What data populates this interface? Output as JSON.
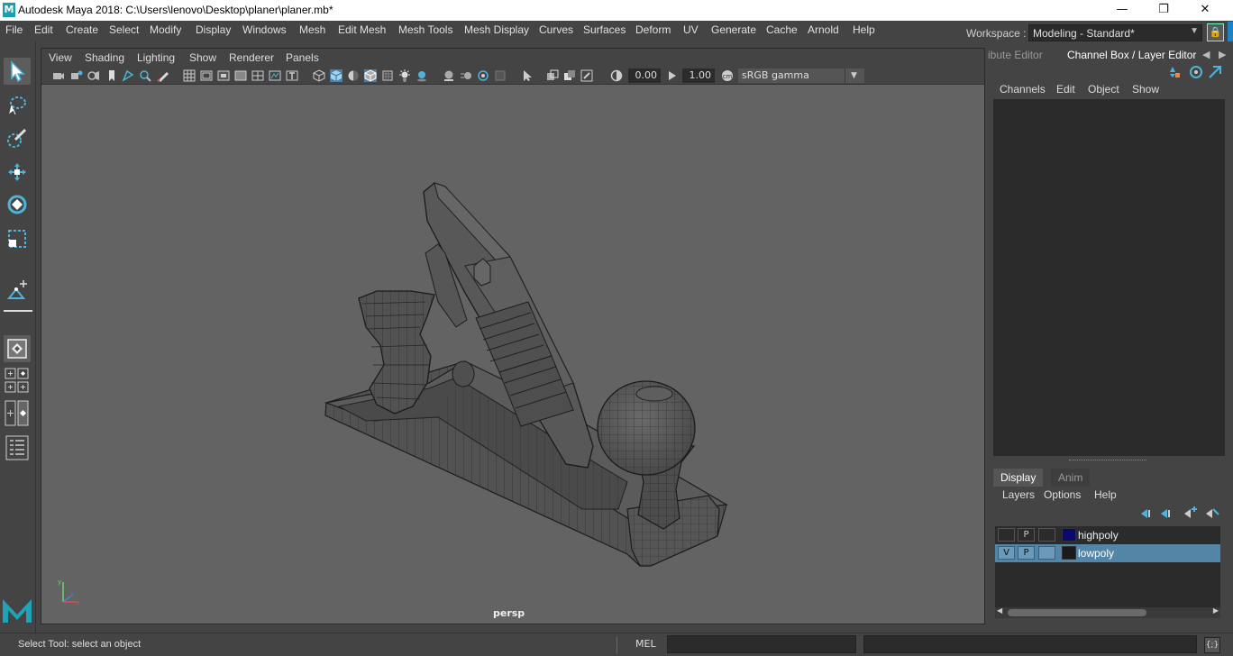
{
  "window": {
    "app_icon": "M",
    "title": "Autodesk Maya 2018: C:\\Users\\lenovo\\Desktop\\planer\\planer.mb*",
    "minimize": "—",
    "restore": "❐",
    "close": "✕"
  },
  "menubar": {
    "items": [
      "File",
      "Edit",
      "Create",
      "Select",
      "Modify",
      "Display",
      "Windows",
      "Mesh",
      "Edit Mesh",
      "Mesh Tools",
      "Mesh Display",
      "Curves",
      "Surfaces",
      "Deform",
      "UV",
      "Generate",
      "Cache",
      "Arnold",
      "Help"
    ]
  },
  "workspace": {
    "label": "Workspace :",
    "value": "Modeling - Standard*"
  },
  "viewport": {
    "menus": [
      "View",
      "Shading",
      "Lighting",
      "Show",
      "Renderer",
      "Panels"
    ],
    "exposure": "0.00",
    "gamma": "1.00",
    "color_space": "sRGB gamma",
    "camera_label": "persp"
  },
  "right_panel": {
    "tab_attribute": "ibute Editor",
    "tab_channel": "Channel Box / Layer Editor",
    "channel_menu": [
      "Channels",
      "Edit",
      "Object",
      "Show"
    ],
    "layer_tabs": [
      "Display",
      "Anim"
    ],
    "layer_menu": [
      "Layers",
      "Options",
      "Help"
    ],
    "layers": [
      {
        "name": "highpoly",
        "v": "",
        "p": "P",
        "color": "#0a0a6e",
        "selected": false
      },
      {
        "name": "lowpoly",
        "v": "V",
        "p": "P",
        "color": "#1b1b1b",
        "selected": true
      }
    ]
  },
  "statusbar": {
    "help_text": "Select Tool: select an object",
    "mel_label": "MEL",
    "script_btn": "{;}"
  },
  "colors": {
    "accent": "#4fb3d9",
    "selection": "#5285a6",
    "viewport_bg": "#636363"
  }
}
